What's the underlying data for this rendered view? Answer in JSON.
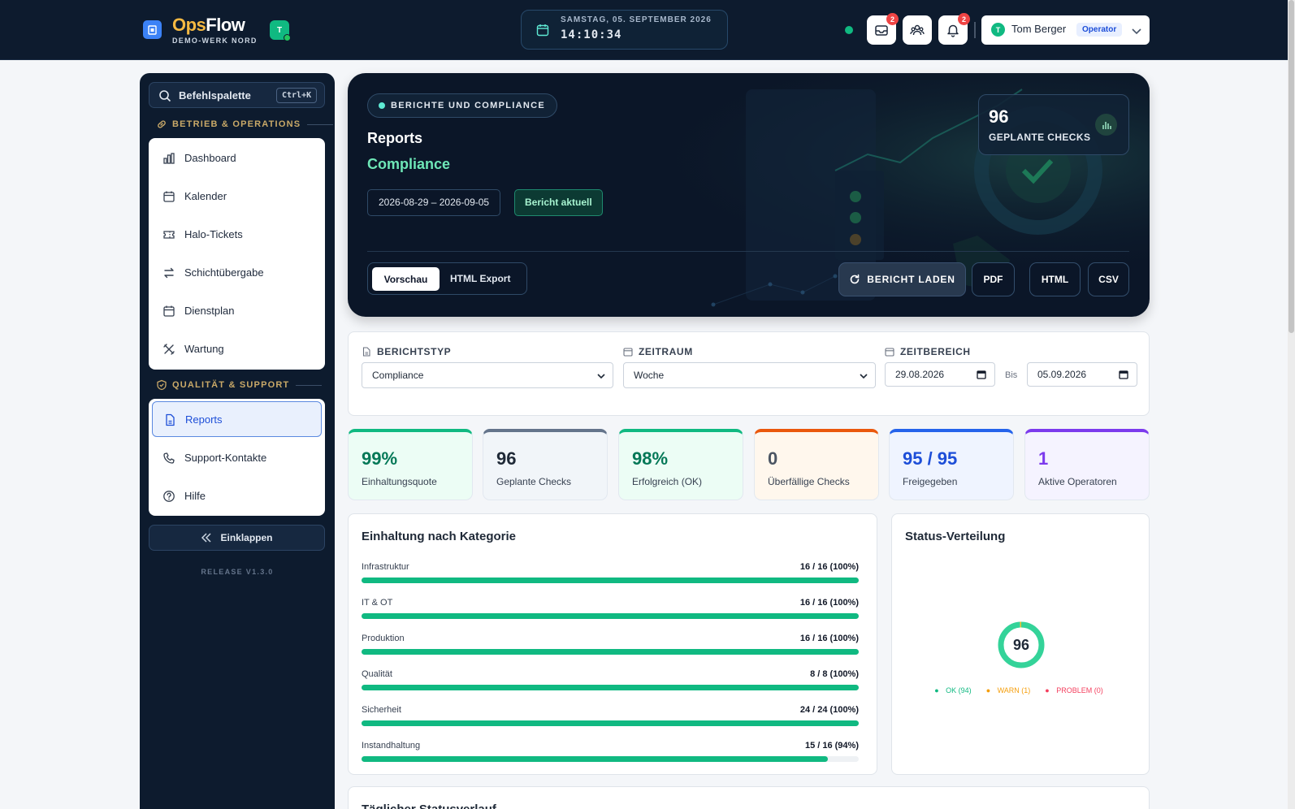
{
  "app": {
    "name_prefix": "Ops",
    "name_suffix": "Flow",
    "subtitle": "DEMO-WERK NORD",
    "badge": "T"
  },
  "clock": {
    "date": "SAMSTAG, 05. SEPTEMBER 2026",
    "time": "14:10:34"
  },
  "header": {
    "notifications": [
      {
        "icon": "inbox-icon",
        "count": "2"
      },
      {
        "icon": "team-icon",
        "count": ""
      },
      {
        "icon": "bell-icon",
        "count": "2"
      }
    ],
    "user": {
      "initial": "T",
      "name": "Tom Berger",
      "role": "Operator"
    }
  },
  "sidebar": {
    "search_label": "Befehlspalette",
    "search_shortcut": "Ctrl+K",
    "section1": "BETRIEB & OPERATIONS",
    "section1_items": [
      {
        "label": "Dashboard",
        "icon": "bar-chart-icon"
      },
      {
        "label": "Kalender",
        "icon": "calendar-icon"
      },
      {
        "label": "Halo-Tickets",
        "icon": "ticket-icon"
      },
      {
        "label": "Schichtübergabe",
        "icon": "swap-icon"
      },
      {
        "label": "Dienstplan",
        "icon": "calendar-icon"
      },
      {
        "label": "Wartung",
        "icon": "tools-icon"
      }
    ],
    "section2": "QUALITÄT & SUPPORT",
    "section2_items": [
      {
        "label": "Reports",
        "icon": "document-icon",
        "active": true
      },
      {
        "label": "Support-Kontakte",
        "icon": "phone-icon"
      },
      {
        "label": "Hilfe",
        "icon": "help-icon"
      }
    ],
    "collapse_label": "Einklappen",
    "release": "RELEASE V1.3.0"
  },
  "hero": {
    "pill": "BERICHTE UND COMPLIANCE",
    "title": "Reports",
    "subtitle": "Compliance",
    "date_range": "2026-08-29 – 2026-09-05",
    "status": "Bericht aktuell",
    "stat_value": "96",
    "stat_label": "GEPLANTE CHECKS",
    "tabs": [
      "Vorschau",
      "HTML Export"
    ],
    "active_tab": "Vorschau",
    "load_button": "BERICHT LADEN",
    "export_buttons": [
      "PDF",
      "HTML",
      "CSV"
    ]
  },
  "filters": {
    "report_type_label": "BERICHTSTYP",
    "report_type_value": "Compliance",
    "period_label": "ZEITRAUM",
    "period_value": "Woche",
    "range_label": "ZEITBEREICH",
    "from": "29.08.2026",
    "to_label": "Bis",
    "to": "05.09.2026"
  },
  "kpis": [
    {
      "value": "99%",
      "label": "Einhaltungsquote",
      "color": "#10b981",
      "bg": "#ecfdf5",
      "text_color": "#047857"
    },
    {
      "value": "96",
      "label": "Geplante Checks",
      "color": "#64748b",
      "bg": "#f1f5f9",
      "text_color": "#1f2937"
    },
    {
      "value": "98%",
      "label": "Erfolgreich (OK)",
      "color": "#10b981",
      "bg": "#ecfdf5",
      "text_color": "#047857"
    },
    {
      "value": "0",
      "label": "Überfällige Checks",
      "color": "#ea580c",
      "bg": "#fff7ed",
      "text_color": "#4b5563"
    },
    {
      "value": "95 / 95",
      "label": "Freigegeben",
      "color": "#2563eb",
      "bg": "#eff4ff",
      "text_color": "#1d4ed8"
    },
    {
      "value": "1",
      "label": "Aktive Operatoren",
      "color": "#7c3aed",
      "bg": "#f5f3ff",
      "text_color": "#7c3aed"
    }
  ],
  "category_card": {
    "title": "Einhaltung nach Kategorie",
    "rows": [
      {
        "name": "Infrastruktur",
        "value": "16 / 16 (100%)",
        "fraction": 1.0
      },
      {
        "name": "IT & OT",
        "value": "16 / 16 (100%)",
        "fraction": 1.0
      },
      {
        "name": "Produktion",
        "value": "16 / 16 (100%)",
        "fraction": 1.0
      },
      {
        "name": "Qualität",
        "value": "8 / 8 (100%)",
        "fraction": 1.0
      },
      {
        "name": "Sicherheit",
        "value": "24 / 24 (100%)",
        "fraction": 1.0
      },
      {
        "name": "Instandhaltung",
        "value": "15 / 16 (94%)",
        "fraction": 0.9375
      }
    ]
  },
  "status_card": {
    "title": "Status-Verteilung",
    "total": "96",
    "segments": [
      {
        "label": "OK (94)",
        "value": 94,
        "color": "#34d399"
      },
      {
        "label": "WARN (1)",
        "value": 1,
        "color": "#fbbf24"
      },
      {
        "label": "PROBLEM (0)",
        "value": 0,
        "color": "#f87171"
      }
    ]
  },
  "bottom_card": {
    "title": "Täglicher Statusverlauf"
  }
}
